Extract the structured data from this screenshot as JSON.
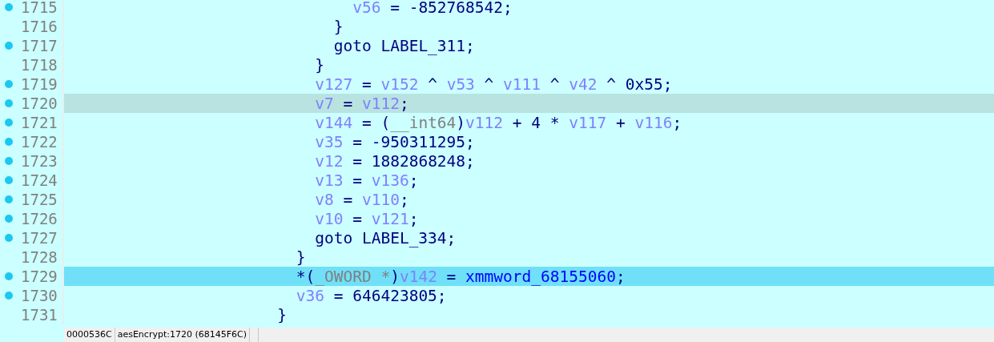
{
  "editor": {
    "lines": [
      {
        "children": [
          {
            "children": [
              {
                "children": [
                  {
                    "children": [
                      {
                        "number": "1715",
                        "breakpoint": true,
                        "selected": false,
                        "synced": false,
                        "tokens": [
                          {
                            "kind": "var",
                            "text": "v56"
                          },
                          {
                            "kind": "code",
                            "text": " = -852768542;"
                          }
                        ]
                      }
                    ]
                  },
                  {
                    "number": "1716",
                    "breakpoint": false,
                    "selected": false,
                    "synced": false,
                    "tokens": [
                      {
                        "kind": "code",
                        "text": "}"
                      }
                    ]
                  },
                  {
                    "number": "1717",
                    "breakpoint": true,
                    "selected": false,
                    "synced": false,
                    "tokens": [
                      {
                        "kind": "code",
                        "text": "goto LABEL_311;"
                      }
                    ]
                  }
                ]
              },
              {
                "number": "1718",
                "breakpoint": false,
                "selected": false,
                "synced": false,
                "tokens": [
                  {
                    "kind": "code",
                    "text": "}"
                  }
                ]
              },
              {
                "number": "1719",
                "breakpoint": true,
                "selected": false,
                "synced": false,
                "tokens": [
                  {
                    "kind": "var",
                    "text": "v127"
                  },
                  {
                    "kind": "code",
                    "text": " = "
                  },
                  {
                    "kind": "var",
                    "text": "v152"
                  },
                  {
                    "kind": "code",
                    "text": " ^ "
                  },
                  {
                    "kind": "var",
                    "text": "v53"
                  },
                  {
                    "kind": "code",
                    "text": " ^ "
                  },
                  {
                    "kind": "var",
                    "text": "v111"
                  },
                  {
                    "kind": "code",
                    "text": " ^ "
                  },
                  {
                    "kind": "var",
                    "text": "v42"
                  },
                  {
                    "kind": "code",
                    "text": " ^ 0x55;"
                  }
                ]
              },
              {
                "number": "1720",
                "breakpoint": true,
                "selected": false,
                "synced": true,
                "tokens": [
                  {
                    "kind": "var",
                    "text": "v7"
                  },
                  {
                    "kind": "code",
                    "text": " = "
                  },
                  {
                    "kind": "var",
                    "text": "v112"
                  },
                  {
                    "kind": "code",
                    "text": ";"
                  }
                ]
              },
              {
                "number": "1721",
                "breakpoint": true,
                "selected": false,
                "synced": false,
                "tokens": [
                  {
                    "kind": "var",
                    "text": "v144"
                  },
                  {
                    "kind": "code",
                    "text": " = ("
                  },
                  {
                    "kind": "type",
                    "text": "__int64"
                  },
                  {
                    "kind": "code",
                    "text": ")"
                  },
                  {
                    "kind": "var",
                    "text": "v112"
                  },
                  {
                    "kind": "code",
                    "text": " + 4 * "
                  },
                  {
                    "kind": "var",
                    "text": "v117"
                  },
                  {
                    "kind": "code",
                    "text": " + "
                  },
                  {
                    "kind": "var",
                    "text": "v116"
                  },
                  {
                    "kind": "code",
                    "text": ";"
                  }
                ]
              },
              {
                "number": "1722",
                "breakpoint": true,
                "selected": false,
                "synced": false,
                "tokens": [
                  {
                    "kind": "var",
                    "text": "v35"
                  },
                  {
                    "kind": "code",
                    "text": " = -950311295;"
                  }
                ]
              },
              {
                "number": "1723",
                "breakpoint": true,
                "selected": false,
                "synced": false,
                "tokens": [
                  {
                    "kind": "var",
                    "text": "v12"
                  },
                  {
                    "kind": "code",
                    "text": " = 1882868248;"
                  }
                ]
              },
              {
                "number": "1724",
                "breakpoint": true,
                "selected": false,
                "synced": false,
                "tokens": [
                  {
                    "kind": "var",
                    "text": "v13"
                  },
                  {
                    "kind": "code",
                    "text": " = "
                  },
                  {
                    "kind": "var",
                    "text": "v136"
                  },
                  {
                    "kind": "code",
                    "text": ";"
                  }
                ]
              },
              {
                "number": "1725",
                "breakpoint": true,
                "selected": false,
                "synced": false,
                "tokens": [
                  {
                    "kind": "var",
                    "text": "v8"
                  },
                  {
                    "kind": "code",
                    "text": " = "
                  },
                  {
                    "kind": "var",
                    "text": "v110"
                  },
                  {
                    "kind": "code",
                    "text": ";"
                  }
                ]
              },
              {
                "number": "1726",
                "breakpoint": true,
                "selected": false,
                "synced": false,
                "tokens": [
                  {
                    "kind": "var",
                    "text": "v10"
                  },
                  {
                    "kind": "code",
                    "text": " = "
                  },
                  {
                    "kind": "var",
                    "text": "v121"
                  },
                  {
                    "kind": "code",
                    "text": ";"
                  }
                ]
              },
              {
                "number": "1727",
                "breakpoint": true,
                "selected": false,
                "synced": false,
                "tokens": [
                  {
                    "kind": "code",
                    "text": "goto LABEL_334;"
                  }
                ]
              }
            ]
          },
          {
            "number": "1728",
            "breakpoint": false,
            "selected": false,
            "synced": false,
            "tokens": [
              {
                "kind": "code",
                "text": "}"
              }
            ]
          },
          {
            "number": "1729",
            "breakpoint": true,
            "selected": true,
            "synced": false,
            "tokens": [
              {
                "kind": "code",
                "text": "*("
              },
              {
                "kind": "type",
                "text": "_OWORD *"
              },
              {
                "kind": "code",
                "text": ")"
              },
              {
                "kind": "var",
                "text": "v142"
              },
              {
                "kind": "code",
                "text": " = "
              },
              {
                "kind": "global",
                "text": "xmmword_68155060"
              },
              {
                "kind": "code",
                "text": ";"
              }
            ]
          },
          {
            "number": "1730",
            "breakpoint": true,
            "selected": false,
            "synced": false,
            "tokens": [
              {
                "kind": "var",
                "text": "v36"
              },
              {
                "kind": "code",
                "text": " = 646423805;"
              }
            ]
          }
        ]
      },
      {
        "number": "1731",
        "breakpoint": false,
        "selected": false,
        "synced": false,
        "tokens": [
          {
            "kind": "code",
            "text": "}"
          }
        ]
      }
    ]
  },
  "status_bar": [
    "0000536C",
    "aesEncrypt:1720 (68145F6C)"
  ]
}
